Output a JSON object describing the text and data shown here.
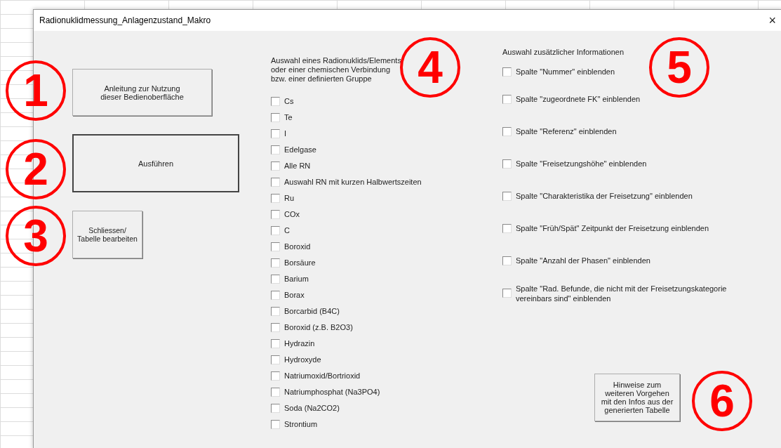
{
  "window": {
    "title": "Radionuklidmessung_Anlagenzustand_Makro",
    "close": "×"
  },
  "buttons": [
    {
      "label": "Anleitung zur Nutzung\ndieser Bedienoberfläche",
      "default": false
    },
    {
      "label": "Ausführen",
      "default": true
    },
    {
      "label": "Schliessen/\nTabelle bearbeiten",
      "default": false
    }
  ],
  "selection": {
    "heading": "Auswahl eines Radionuklids/Elements\noder einer chemischen Verbindung\nbzw. einer definierten Gruppe",
    "options": [
      {
        "label": "Cs",
        "checked": false
      },
      {
        "label": "Te",
        "checked": false
      },
      {
        "label": "I",
        "checked": false
      },
      {
        "label": "Edelgase",
        "checked": false
      },
      {
        "label": "Alle RN",
        "checked": false
      },
      {
        "label": "Auswahl RN mit kurzen Halbwertszeiten",
        "checked": false
      },
      {
        "label": "Ru",
        "checked": false
      },
      {
        "label": "COx",
        "checked": false
      },
      {
        "label": "C",
        "checked": false
      },
      {
        "label": "Boroxid",
        "checked": false
      },
      {
        "label": "Borsäure",
        "checked": false
      },
      {
        "label": "Barium",
        "checked": false
      },
      {
        "label": "Borax",
        "checked": false
      },
      {
        "label": "Borcarbid (B4C)",
        "checked": false
      },
      {
        "label": "Boroxid (z.B. B2O3)",
        "checked": false
      },
      {
        "label": "Hydrazin",
        "checked": false
      },
      {
        "label": "Hydroxyde",
        "checked": false
      },
      {
        "label": "Natriumoxid/Bortrioxid",
        "checked": false
      },
      {
        "label": "Natriumphosphat (Na3PO4)",
        "checked": false
      },
      {
        "label": "Soda (Na2CO2)",
        "checked": false
      },
      {
        "label": "Strontium",
        "checked": false
      }
    ]
  },
  "additional": {
    "heading": "Auswahl zusätzlicher Informationen",
    "options": [
      {
        "label": "Spalte \"Nummer\" einblenden",
        "checked": false
      },
      {
        "label": "Spalte \"zugeordnete FK\" einblenden",
        "checked": false
      },
      {
        "label": "Spalte \"Referenz\" einblenden",
        "checked": false
      },
      {
        "label": "Spalte \"Freisetzungshöhe\" einblenden",
        "checked": false
      },
      {
        "label": "Spalte \"Charakteristika der Freisetzung\"  einblenden",
        "checked": false
      },
      {
        "label": "Spalte \"Früh/Spät\" Zeitpunkt der Freisetzung einblenden",
        "checked": false
      },
      {
        "label": "Spalte \"Anzahl der Phasen\" einblenden",
        "checked": false
      },
      {
        "label": "Spalte \"Rad. Befunde, die nicht mit der Freisetzungskategorie\nvereinbars sind\" einblenden",
        "checked": false
      }
    ],
    "button": {
      "label": "Hinweise zum\nweiteren Vorgehen\nmit den Infos aus der\ngenerierten Tabelle",
      "default": false
    }
  },
  "callouts": [
    {
      "label": "1"
    },
    {
      "label": "2"
    },
    {
      "label": "3"
    },
    {
      "label": "4"
    },
    {
      "label": "5"
    },
    {
      "label": "6"
    }
  ]
}
